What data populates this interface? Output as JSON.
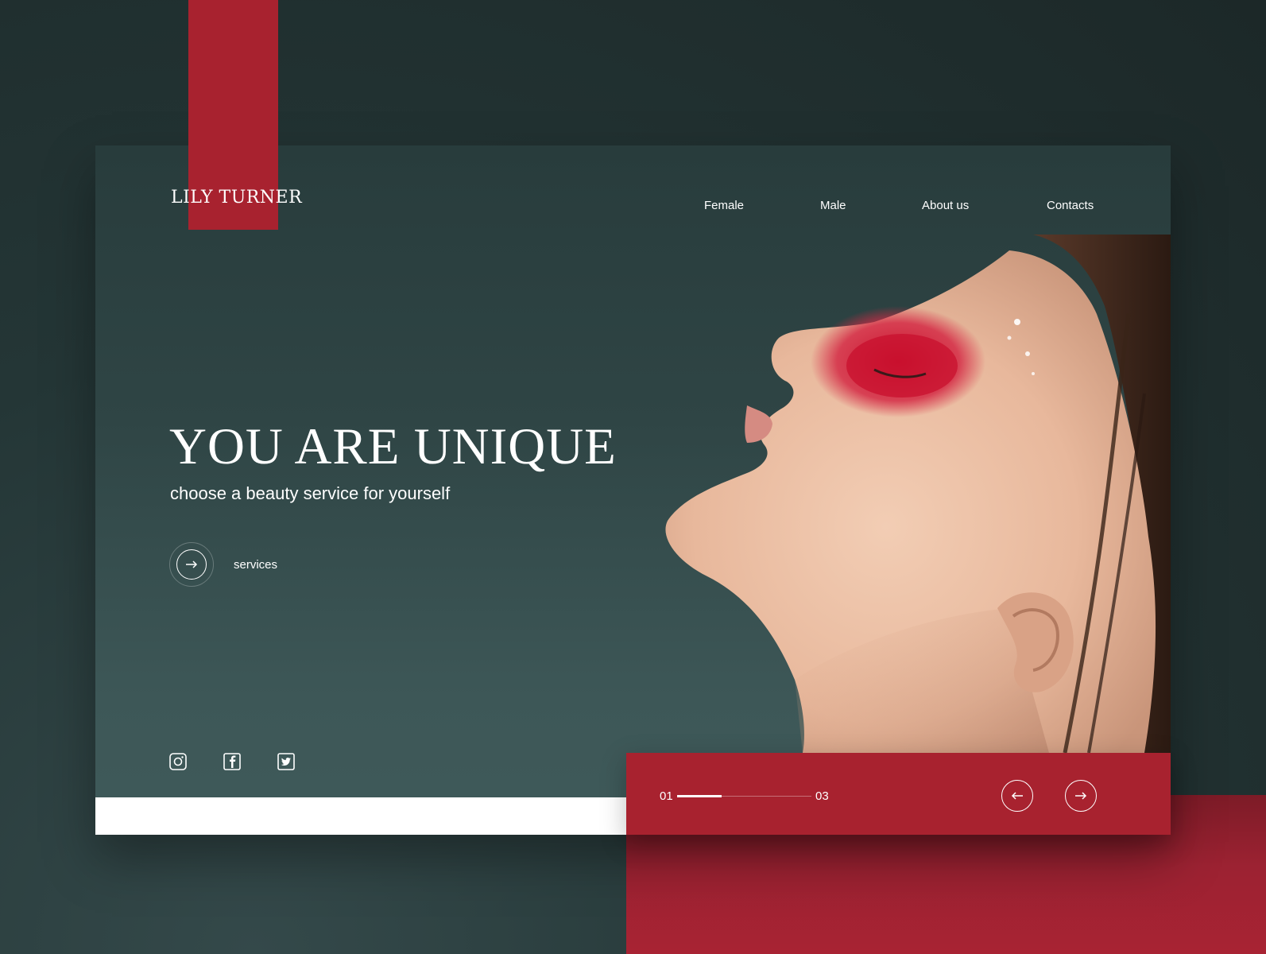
{
  "brand": {
    "name": "LILY TURNER",
    "accent_color": "#a8222f",
    "background_color": "#2f4545"
  },
  "nav": {
    "items": [
      {
        "label": "Female"
      },
      {
        "label": "Male"
      },
      {
        "label": "About us"
      },
      {
        "label": "Contacts"
      }
    ]
  },
  "hero": {
    "title": "YOU ARE UNIQUE",
    "subtitle": "choose a beauty service for yourself",
    "cta_label": "services",
    "cta_icon": "arrow-right-icon",
    "image": "woman-profile-red-eye-makeup"
  },
  "social": [
    {
      "icon": "instagram-icon"
    },
    {
      "icon": "facebook-icon"
    },
    {
      "icon": "twitter-icon"
    }
  ],
  "slider": {
    "current": "01",
    "total": "03",
    "progress": 0.33,
    "prev_icon": "arrow-left-icon",
    "next_icon": "arrow-right-icon"
  }
}
